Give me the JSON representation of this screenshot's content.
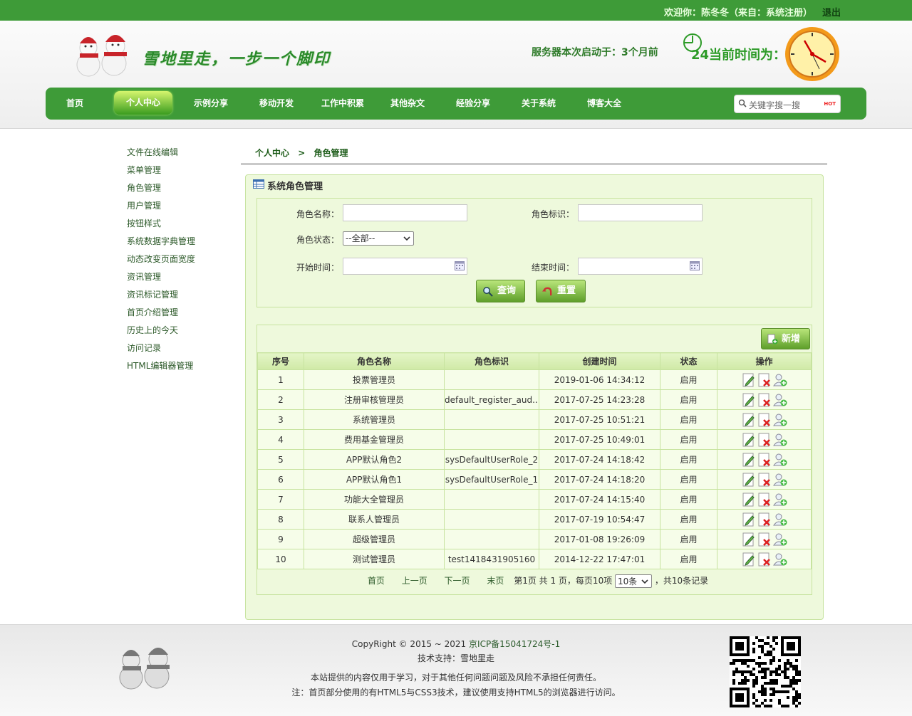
{
  "topbar": {
    "welcome": "欢迎你：陈冬冬（来自：系统注册）",
    "logout": "退出"
  },
  "header": {
    "slogan": "雪地里走，一步一个脚印",
    "uptime": "服务器本次启动于：3个月前",
    "current_time": "24当前时间为："
  },
  "nav": {
    "items": [
      "首页",
      "个人中心",
      "示例分享",
      "移动开发",
      "工作中积累",
      "其他杂文",
      "经验分享",
      "关于系统",
      "博客大全"
    ],
    "active_index": 1,
    "search_placeholder": "关键字搜一搜",
    "hot_label": "HOT"
  },
  "sidebar": {
    "items": [
      "文件在线编辑",
      "菜单管理",
      "角色管理",
      "用户管理",
      "按钮样式",
      "系统数据字典管理",
      "动态改变页面宽度",
      "资讯管理",
      "资讯标记管理",
      "首页介绍管理",
      "历史上的今天",
      "访问记录",
      "HTML编辑器管理"
    ]
  },
  "breadcrumb": {
    "home": "个人中心",
    "sep": ">",
    "current": "角色管理"
  },
  "panel": {
    "title": "系统角色管理"
  },
  "form": {
    "role_name_label": "角色名称：",
    "role_code_label": "角色标识：",
    "status_label": "角色状态：",
    "status_value": "--全部--",
    "start_label": "开始时间：",
    "end_label": "结束时间：",
    "query_button": "查询",
    "reset_button": "重置"
  },
  "grid": {
    "add_button": "新增",
    "columns": [
      "序号",
      "角色名称",
      "角色标识",
      "创建时间",
      "状态",
      "操作"
    ],
    "rows": [
      [
        "1",
        "投票管理员",
        "",
        "2019-01-06 14:34:12",
        "启用"
      ],
      [
        "2",
        "注册审核管理员",
        "default_register_aud...",
        "2017-07-25 14:23:28",
        "启用"
      ],
      [
        "3",
        "系统管理员",
        "",
        "2017-07-25 10:51:21",
        "启用"
      ],
      [
        "4",
        "费用基金管理员",
        "",
        "2017-07-25 10:49:01",
        "启用"
      ],
      [
        "5",
        "APP默认角色2",
        "sysDefaultUserRole_2",
        "2017-07-24 14:18:42",
        "启用"
      ],
      [
        "6",
        "APP默认角色1",
        "sysDefaultUserRole_1",
        "2017-07-24 14:18:20",
        "启用"
      ],
      [
        "7",
        "功能大全管理员",
        "",
        "2017-07-24 14:15:40",
        "启用"
      ],
      [
        "8",
        "联系人管理员",
        "",
        "2017-07-19 10:54:47",
        "启用"
      ],
      [
        "9",
        "超级管理员",
        "",
        "2017-01-08 19:26:09",
        "启用"
      ],
      [
        "10",
        "测试管理员",
        "test1418431905160",
        "2014-12-22 17:47:01",
        "启用"
      ]
    ]
  },
  "pager": {
    "first": "首页",
    "prev": "上一页",
    "next": "下一页",
    "last": "末页",
    "info": "第1页 共 1 页，每页10项",
    "page_size": "10条",
    "total": "，共10条记录"
  },
  "footer": {
    "copyright": "CopyRight © 2015 ~ 2021",
    "icp": "京ICP备15041724号-1",
    "support": "技术支持：雪地里走",
    "disclaimer": "本站提供的内容仅用于学习，对于其他任何问题问题及风险不承担任何责任。",
    "note": "注：首页部分使用的有HTML5与CSS3技术，建议使用支持HTML5的浏览器进行访问。"
  },
  "colors": {
    "brand_green": "#3e9b38",
    "panel_bg": "#eef9dc",
    "border": "#c7e39f"
  },
  "icons": [
    "snowman-logo-icon",
    "timer-icon",
    "clock-icon",
    "search-icon",
    "hot-icon",
    "table-icon",
    "calendar-icon",
    "query-icon",
    "reset-icon",
    "add-icon",
    "edit-icon",
    "delete-icon",
    "assign-user-icon",
    "qrcode-icon"
  ]
}
